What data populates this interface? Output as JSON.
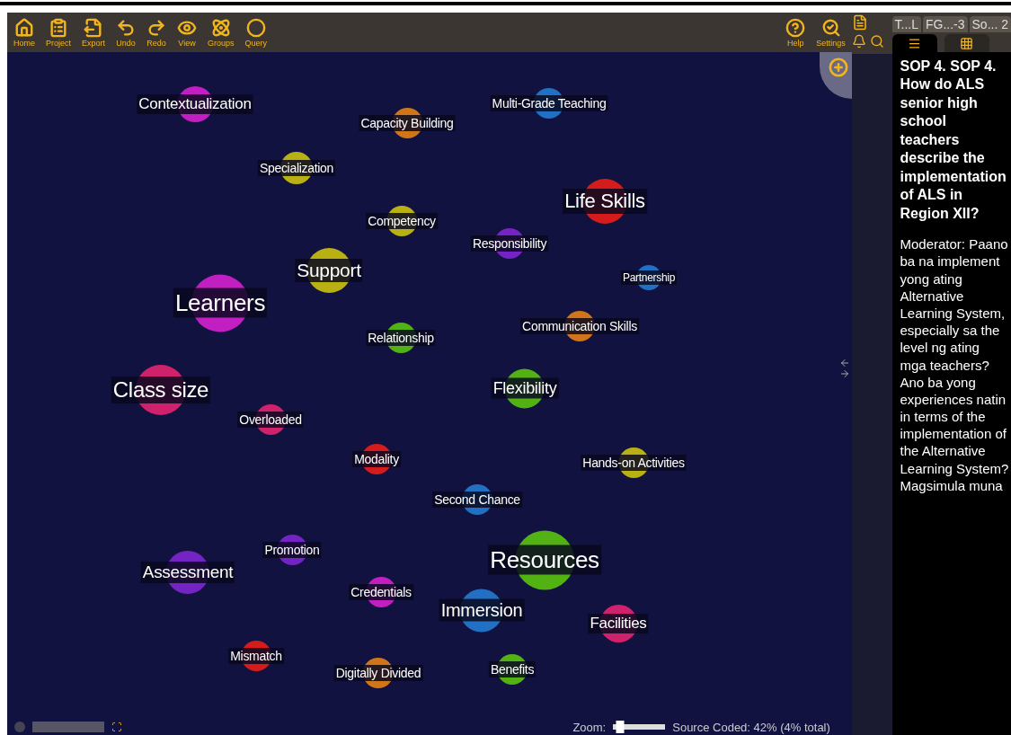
{
  "toolbar": {
    "left": [
      {
        "kind": "home",
        "label": "Home"
      },
      {
        "kind": "project",
        "label": "Project"
      },
      {
        "kind": "export",
        "label": "Export"
      },
      {
        "kind": "undo",
        "label": "Undo"
      },
      {
        "kind": "redo",
        "label": "Redo"
      },
      {
        "kind": "view",
        "label": "View"
      },
      {
        "kind": "groups",
        "label": "Groups"
      },
      {
        "kind": "query",
        "label": "Query"
      }
    ],
    "right": [
      {
        "kind": "help",
        "label": "Help"
      },
      {
        "kind": "settings",
        "label": "Settings"
      }
    ]
  },
  "document_tabs": [
    "T...L",
    "FG...-3",
    "So... 2"
  ],
  "panel_tabs": [
    {
      "kind": "menu",
      "selected": true
    },
    {
      "kind": "grid",
      "selected": false
    }
  ],
  "nodes": [
    {
      "label": "Contextualization",
      "color": "#c21fc2"
    },
    {
      "label": "Capacity Building",
      "color": "#d0751a"
    },
    {
      "label": "Multi-Grade Teaching",
      "color": "#2270c4"
    },
    {
      "label": "Specialization",
      "color": "#b9b014"
    },
    {
      "label": "Life Skills",
      "color": "#d41c1c"
    },
    {
      "label": "Competency",
      "color": "#b9b014"
    },
    {
      "label": "Responsibility",
      "color": "#7424c4"
    },
    {
      "label": "Support",
      "color": "#b9b014"
    },
    {
      "label": "Partnership",
      "color": "#2270c4"
    },
    {
      "label": "Learners",
      "color": "#c21fc2"
    },
    {
      "label": "Communication Skills",
      "color": "#d0751a"
    },
    {
      "label": "Relationship",
      "color": "#52b214"
    },
    {
      "label": "Class size",
      "color": "#d0226c"
    },
    {
      "label": "Flexibility",
      "color": "#52b214"
    },
    {
      "label": "Overloaded",
      "color": "#d0226c"
    },
    {
      "label": "Modality",
      "color": "#d41c1c"
    },
    {
      "label": "Hands-on Activities",
      "color": "#b9b014"
    },
    {
      "label": "Second Chance",
      "color": "#2270c4"
    },
    {
      "label": "Resources",
      "color": "#52b214"
    },
    {
      "label": "Promotion",
      "color": "#7424c4"
    },
    {
      "label": "Assessment",
      "color": "#7424c4"
    },
    {
      "label": "Credentials",
      "color": "#c21fc2"
    },
    {
      "label": "Immersion",
      "color": "#2270c4"
    },
    {
      "label": "Facilities",
      "color": "#d0226c"
    },
    {
      "label": "Mismatch",
      "color": "#d41c1c"
    },
    {
      "label": "Digitally Divided",
      "color": "#d0751a"
    },
    {
      "label": "Benefits",
      "color": "#52b214"
    }
  ],
  "status": {
    "zoom_label": "Zoom:",
    "zoom": {
      "level": 0.05
    },
    "coded": "Source Coded: 42% (4% total)"
  },
  "panel": {
    "heading": "SOP 4. SOP 4. How do ALS senior high school teachers describe the implementation of ALS in Region XII?",
    "body": "Moderator: Paano ba na implement yong ating Alternative Learning System, especially sa the level ng ating mga teachers? Ano ba yong experiences natin  in terms of the implementation of the Alternative Learning System? Magsimula muna"
  }
}
